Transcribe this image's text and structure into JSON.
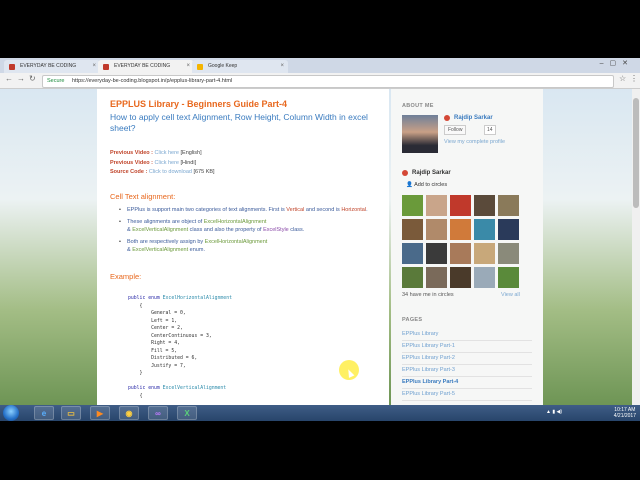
{
  "browser": {
    "tabs": [
      {
        "label": "EVERYDAY BE CODING",
        "active": false
      },
      {
        "label": "EVERYDAY BE CODING",
        "active": true
      },
      {
        "label": "Google Keep",
        "active": false
      }
    ],
    "address": {
      "secure_label": "Secure",
      "url": "https://everyday-be-coding.blogspot.in/p/epplus-library-part-4.html"
    }
  },
  "article": {
    "title": "EPPLUS Library - Beginners Guide Part-4",
    "subtitle": "How to apply cell text Alignment, Row Height, Column Width in excel sheet?",
    "links": [
      {
        "label": "Previous Video :",
        "link": "Click here",
        "suffix": "[English]"
      },
      {
        "label": "Previous Video :",
        "link": "Click here",
        "suffix": "[Hindi]"
      },
      {
        "label": "Source Code :",
        "link": "Click to download",
        "suffix": "[675 KB]"
      }
    ],
    "section_heading": "Cell Text alignment:",
    "bullets": {
      "b1_pre": "EPPlus is support main two categories of text alignments. First is ",
      "b1_vertical": "Vertical",
      "b1_mid": " and second is ",
      "b1_horizontal": "Horizontal",
      "b1_end": ".",
      "b2_pre": "These alignments are object of ",
      "b2_obj1": "ExcelHorizontalAlignment",
      "b2_amp": "& ",
      "b2_obj2": "ExcelVerticalAlignment",
      "b2_mid": " class and also the property of ",
      "b2_obj3": "ExcelStyle",
      "b2_end": " class.",
      "b3_pre": "Both are respectively assign by ",
      "b3_obj1": "ExcelHorizontalAlignment",
      "b3_amp": "& ",
      "b3_obj2": "ExcelVerticalAlignment",
      "b3_end": " enum."
    },
    "example_label": "Example:",
    "code": {
      "l1_kw": "public enum ",
      "l1_type": "ExcelHorizontalAlignment",
      "body": "    {\n        General = 0,\n        Left = 1,\n        Center = 2,\n        CenterContinuous = 3,\n        Right = 4,\n        Fill = 5,\n        Distributed = 6,\n        Justify = 7,\n    }",
      "l2_kw": "public enum ",
      "l2_type": "ExcelVerticalAlignment",
      "l2_brace": "{"
    }
  },
  "sidebar": {
    "about_heading": "ABOUT ME",
    "profile_name": "Rajdip Sarkar",
    "follow_label": "Follow",
    "follow_count": "14",
    "view_profile": "View my complete profile",
    "gplus_name": "Rajdip Sarkar",
    "add_circles": "Add to circles",
    "circles_text": "34 have me in circles",
    "view_all": "View all",
    "pages_heading": "PAGES",
    "pages": [
      {
        "label": "EPPlus Library",
        "current": false
      },
      {
        "label": "EPPlus Library Part-1",
        "current": false
      },
      {
        "label": "EPPlus Library Part-2",
        "current": false
      },
      {
        "label": "EPPlus Library Part-3",
        "current": false
      },
      {
        "label": "EPPlus Library Part-4",
        "current": true
      },
      {
        "label": "EPPlus Library Part-5",
        "current": false
      }
    ]
  },
  "taskbar": {
    "time": "10:17 AM",
    "date": "4/21/2017"
  }
}
